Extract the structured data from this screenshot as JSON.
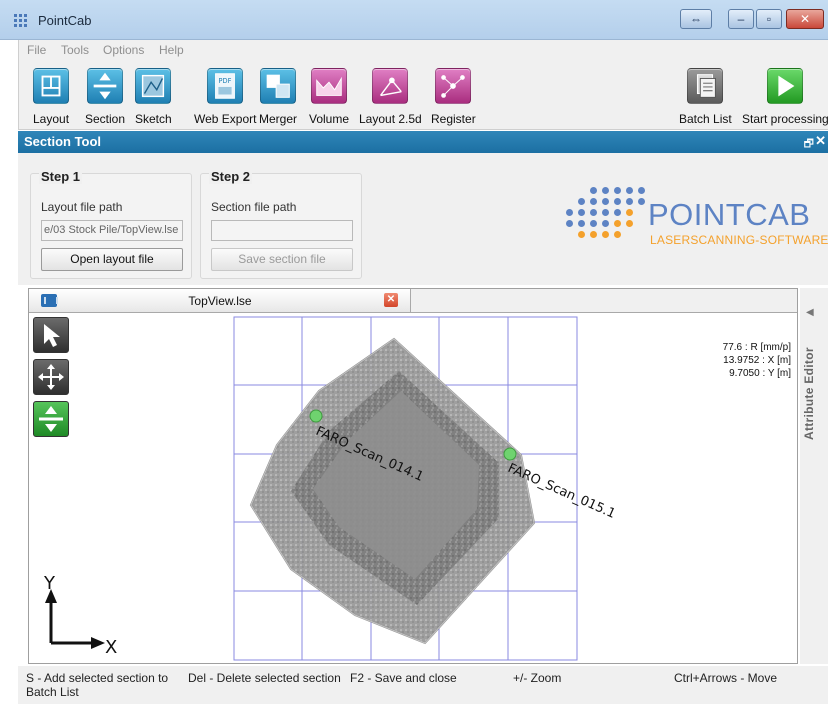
{
  "window": {
    "title": "PointCab",
    "controls": {
      "snap": "⇔",
      "minimize": "–",
      "maximize": "▫",
      "close": "✕"
    }
  },
  "menu": {
    "items": [
      "File",
      "Tools",
      "Options",
      "Help"
    ]
  },
  "toolbar": {
    "tools": [
      {
        "label": "Layout",
        "icon": "layout-icon",
        "color": "#2a8fbf"
      },
      {
        "label": "Section",
        "icon": "section-icon",
        "color": "#2a8fbf"
      },
      {
        "label": "Sketch",
        "icon": "sketch-icon",
        "color": "#2a8fbf"
      },
      {
        "label": "Web Export",
        "icon": "web-export-icon",
        "color": "#2a8fbf"
      },
      {
        "label": "Merger",
        "icon": "merger-icon",
        "color": "#2a8fbf"
      },
      {
        "label": "Volume",
        "icon": "volume-icon",
        "color": "#b8338f"
      },
      {
        "label": "Layout 2.5d",
        "icon": "layout-2-5d-icon",
        "color": "#b8338f"
      },
      {
        "label": "Register",
        "icon": "register-icon",
        "color": "#b8338f"
      },
      {
        "label": "Batch List",
        "icon": "batch-list-icon",
        "color": "#666666"
      },
      {
        "label": "Start processing",
        "icon": "play-icon",
        "color": "#2ca52c"
      }
    ]
  },
  "section_tool": {
    "title": "Section Tool",
    "float_icon": "🗗",
    "close_icon": "✕",
    "step1": {
      "title": "Step 1",
      "field_label": "Layout file path",
      "field_value": "e/03 Stock Pile/TopView.lse",
      "button": "Open layout file"
    },
    "step2": {
      "title": "Step 2",
      "field_label": "Section file path",
      "field_value": "",
      "button": "Save section file"
    }
  },
  "logo": {
    "name": "POINTCAB",
    "tagline": "LASERSCANNING-SOFTWARE"
  },
  "document": {
    "tab_title": "TopView.lse",
    "readout": {
      "r": "77.6 : R [mm/p]",
      "x": "13.9752 : X [m]",
      "y": "9.7050 : Y [m]"
    },
    "scan_labels": [
      "FARO_Scan_014.1",
      "FARO_Scan_015.1"
    ],
    "axis_x": "X",
    "axis_y": "Y"
  },
  "side_panel": {
    "label": "Attribute Editor",
    "arrow": "◀"
  },
  "status": {
    "add_section": "S - Add selected section to Batch List",
    "delete_section": "Del - Delete selected section",
    "save_close": "F2 - Save and close",
    "zoom": "+/- Zoom",
    "move": "Ctrl+Arrows - Move"
  },
  "colors": {
    "section_header": "#1f72a6",
    "logo_blue": "#5d83c4",
    "logo_orange": "#f4a12c",
    "grid": "#8a8ae0",
    "scan_point": "#6fd36f"
  }
}
